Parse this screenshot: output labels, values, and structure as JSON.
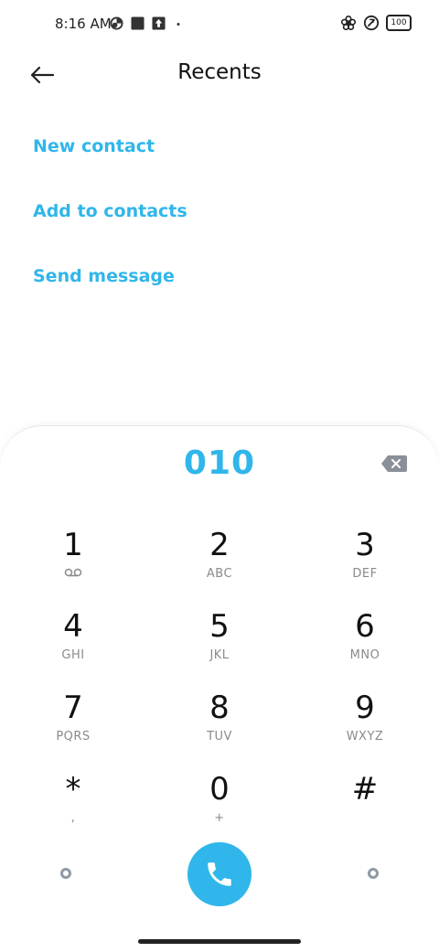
{
  "status_bar": {
    "time": "8:16 AM",
    "battery": "100",
    "left_icons": [
      "data-saver-icon",
      "square-notification-icon",
      "upload-notification-icon",
      "dot-icon"
    ],
    "right_icons": [
      "flower-icon",
      "no-sim-icon",
      "battery-icon"
    ]
  },
  "header": {
    "title": "Recents",
    "back_icon": "back-arrow-icon"
  },
  "actions": [
    {
      "label": "New contact"
    },
    {
      "label": "Add to contacts"
    },
    {
      "label": "Send message"
    }
  ],
  "dialpad": {
    "number": "010",
    "keys": [
      {
        "digit": "1",
        "letters": ""
      },
      {
        "digit": "2",
        "letters": "ABC"
      },
      {
        "digit": "3",
        "letters": "DEF"
      },
      {
        "digit": "4",
        "letters": "GHI"
      },
      {
        "digit": "5",
        "letters": "JKL"
      },
      {
        "digit": "6",
        "letters": "MNO"
      },
      {
        "digit": "7",
        "letters": "PQRS"
      },
      {
        "digit": "8",
        "letters": "TUV"
      },
      {
        "digit": "9",
        "letters": "WXYZ"
      },
      {
        "digit": "*",
        "letters": ","
      },
      {
        "digit": "0",
        "letters": "+"
      },
      {
        "digit": "#",
        "letters": ""
      }
    ]
  },
  "colors": {
    "accent": "#30b6ea",
    "text": "#111111",
    "subtext": "#8a8a8a"
  }
}
